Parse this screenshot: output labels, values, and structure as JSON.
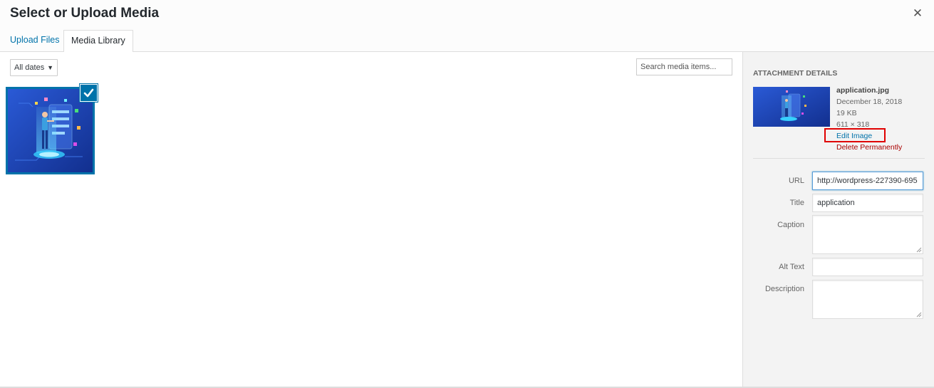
{
  "modal": {
    "title": "Select or Upload Media",
    "close_icon": "close-icon"
  },
  "tabs": [
    {
      "label": "Upload Files",
      "active": false
    },
    {
      "label": "Media Library",
      "active": true
    }
  ],
  "toolbar": {
    "date_filter": "All dates",
    "search_placeholder": "Search media items..."
  },
  "attachment": {
    "heading": "Attachment Details",
    "filename": "application.jpg",
    "date": "December 18, 2018",
    "size": "19 KB",
    "dimensions": "611 × 318",
    "edit_label": "Edit Image",
    "delete_label": "Delete Permanently"
  },
  "fields": {
    "url_label": "URL",
    "url_value": "http://wordpress-227390-695",
    "title_label": "Title",
    "title_value": "application",
    "caption_label": "Caption",
    "caption_value": "",
    "alt_label": "Alt Text",
    "alt_value": "",
    "description_label": "Description",
    "description_value": ""
  },
  "colors": {
    "accent": "#0073aa",
    "delete": "#aa0000",
    "highlight": "#e00000"
  }
}
